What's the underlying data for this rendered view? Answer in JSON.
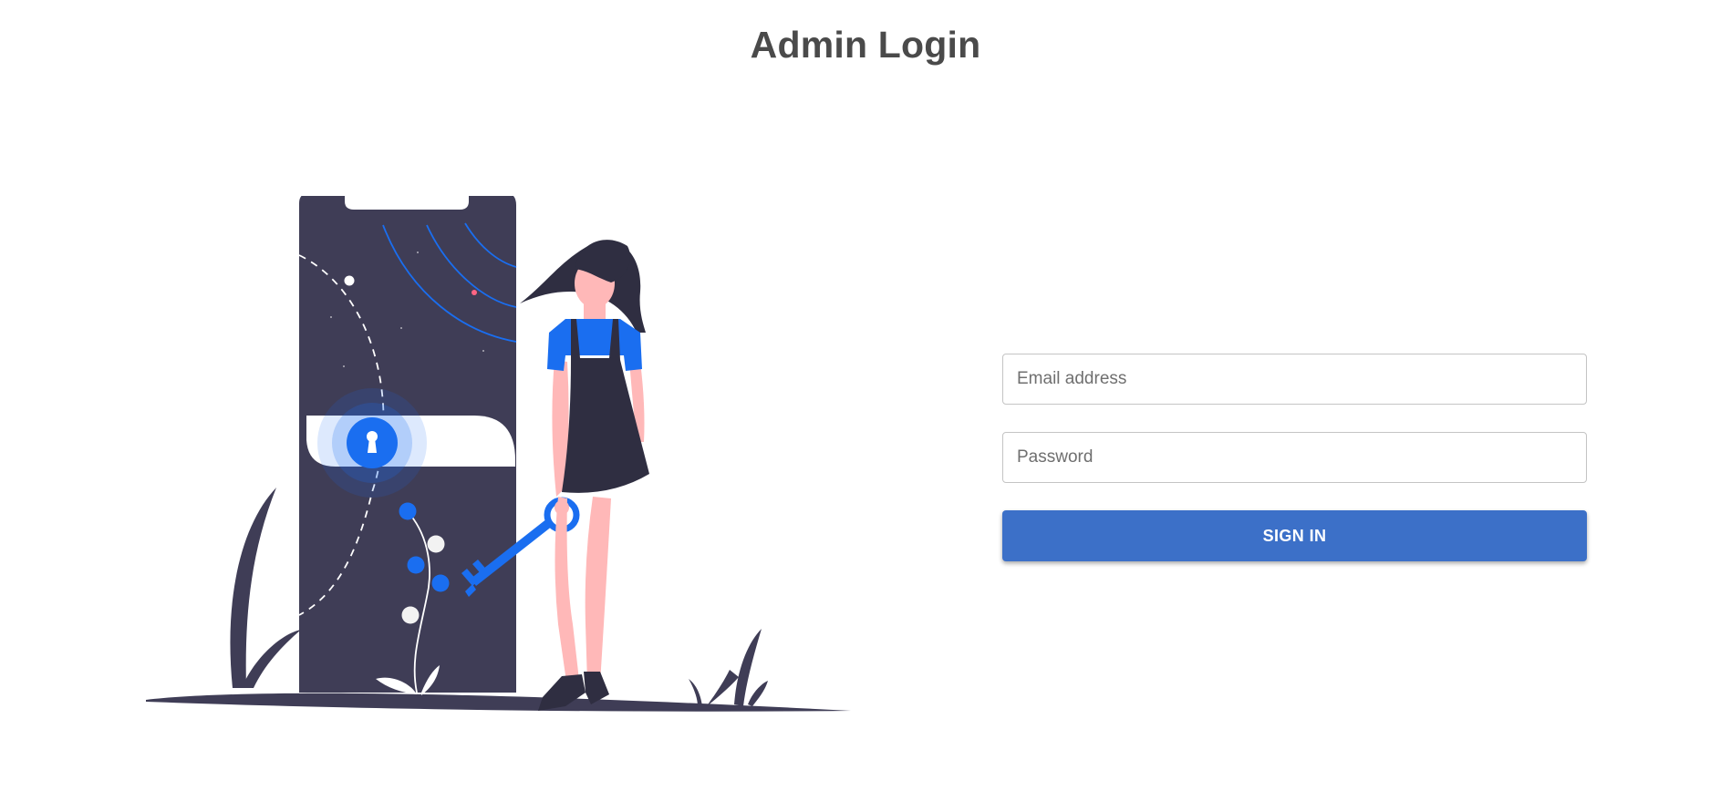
{
  "page": {
    "title": "Admin Login"
  },
  "form": {
    "email": {
      "placeholder": "Email address",
      "value": ""
    },
    "password": {
      "placeholder": "Password",
      "value": ""
    },
    "submit_label": "SIGN IN"
  },
  "colors": {
    "accent": "#3c70c8",
    "illustration_blue": "#1a6ef0",
    "illustration_dark": "#3f3d56",
    "skin": "#ffb8b8"
  },
  "illustration": {
    "icon": "login-illustration"
  }
}
